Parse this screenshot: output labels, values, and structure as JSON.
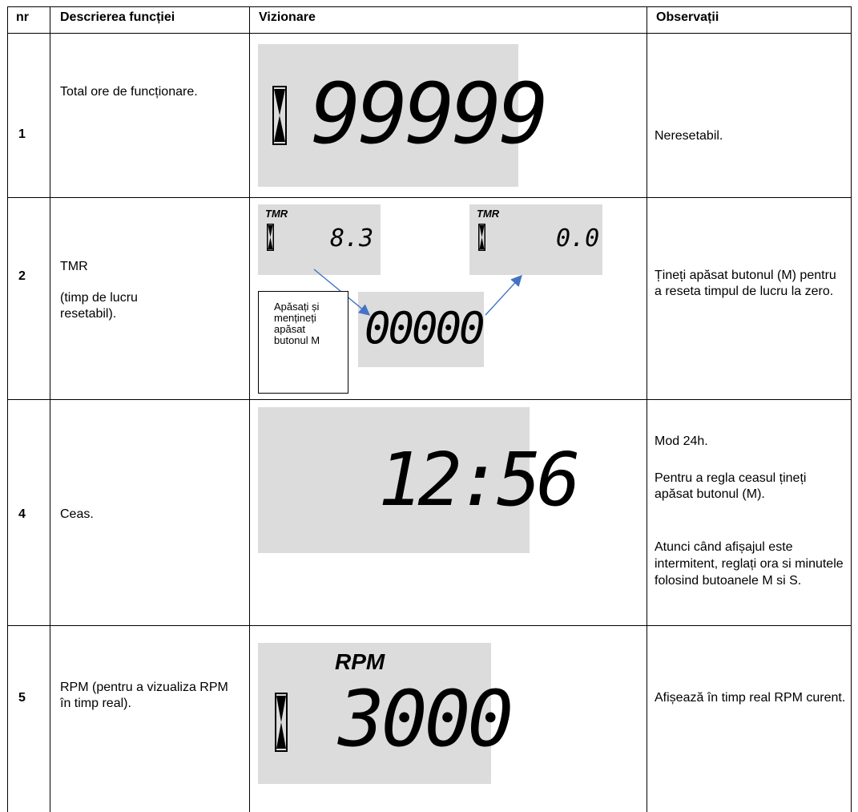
{
  "table": {
    "headers": [
      "nr",
      "Descrierea funcției",
      "Vizionare",
      "Observații"
    ],
    "rows": [
      {
        "nr": "1",
        "description": "Total ore de funcționare.",
        "display": "99999",
        "notes": [
          "Neresetabil."
        ]
      },
      {
        "nr": "2",
        "description": [
          "TMR",
          "(timp de lucru resetabil)."
        ],
        "display_before": {
          "label": "TMR",
          "value": "8.3"
        },
        "display_after": {
          "label": "TMR",
          "value": "0.0"
        },
        "display_mid": "00000",
        "instruction": "Apăsați și mențineți apăsat butonul M",
        "notes": [
          "Țineți  apăsat butonul (M) pentru a reseta timpul de lucru la zero."
        ]
      },
      {
        "nr": "4",
        "description": "Ceas.",
        "display": "12:56",
        "notes": [
          "Mod 24h.",
          "Pentru a regla ceasul țineți apăsat butonul (M).",
          "Atunci când  afișajul este intermitent, reglați ora si minutele folosind butoanele M si S."
        ]
      },
      {
        "nr": "5",
        "description": "RPM (pentru a vizualiza RPM în timp real).",
        "display": {
          "label": "RPM",
          "value": "3000"
        },
        "notes": [
          "Afișează în timp real RPM curent."
        ]
      }
    ]
  },
  "colors": {
    "lcd_background": "#dcdcdc",
    "arrow": "#4472c4"
  }
}
